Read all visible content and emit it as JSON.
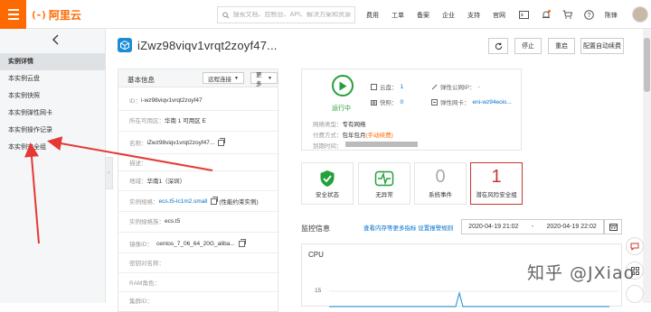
{
  "colors": {
    "brand": "#ff6a00",
    "link": "#0070cc",
    "running": "#23a03a",
    "risk": "#c7372f",
    "arrow": "#e53935"
  },
  "topbar": {
    "logo_text": "阿里云",
    "search_placeholder": "搜索文档、控制台、API、解决方案和资源",
    "nav": [
      "费用",
      "工单",
      "备案",
      "企业",
      "支持",
      "官网"
    ],
    "user_name": "陈锋",
    "icons": [
      "terminal-icon",
      "bell-icon",
      "cart-icon",
      "help-icon"
    ]
  },
  "sidebar": {
    "back_icon": "chevron-left-icon",
    "items": [
      {
        "label": "实例详情",
        "active": true
      },
      {
        "label": "本实例云盘",
        "active": false
      },
      {
        "label": "本实例快照",
        "active": false
      },
      {
        "label": "本实例弹性网卡",
        "active": false
      },
      {
        "label": "本实例操作记录",
        "active": false
      },
      {
        "label": "本实例安全组",
        "active": false
      }
    ]
  },
  "instance": {
    "title": "iZwz98viqv1vrqt2zoyf47...",
    "buttons": {
      "stop": "停止",
      "restart": "重启",
      "autorenew": "配置自动续费"
    }
  },
  "basic_info": {
    "title": "基本信息",
    "remote_btn": "远程连接",
    "more_btn": "更多",
    "rows": {
      "id": {
        "k": "ID：",
        "v": "i-wz98viqv1vrqt2zoyf47"
      },
      "zone": {
        "k": "所在可用区：",
        "v": "华南 1 可用区 E"
      },
      "name": {
        "k": "名称：",
        "v": "iZwz98viqv1vrqt2zoyf47..."
      },
      "desc": {
        "k": "描述：",
        "v": ""
      },
      "region": {
        "k": "地域：",
        "v": "华南1（深圳）"
      },
      "spec": {
        "k": "实例规格：",
        "v": "ecs.t5-lc1m2.small",
        "extra": "(性能约束实例)"
      },
      "family": {
        "k": "实例规格族：",
        "v": "ecs.t5"
      },
      "image": {
        "k": "镜像ID：",
        "v": "centos_7_06_64_20G_aliba..."
      },
      "keypair": {
        "k": "密钥对名称：",
        "v": ""
      },
      "ram": {
        "k": "RAM角色：",
        "v": ""
      },
      "group": {
        "k": "集群ID：",
        "v": ""
      }
    }
  },
  "status": {
    "run_label": "运行中",
    "disk_label": "云盘：",
    "disk_count": "1",
    "snapshot_label": "快照：",
    "snapshot_count": "0",
    "eip_label": "弹性公网IP：",
    "eip_value": "-",
    "eni_label": "弹性网卡：",
    "eni_value": "eni-wz94eois...",
    "net_type_label": "网络类型：",
    "net_type_value": "专有网络",
    "pay_label": "付费方式：",
    "pay_value": "包年包月",
    "pay_warn": "(手动续费)",
    "expire_label": "到期时间："
  },
  "cards": [
    {
      "label": "安全状态",
      "icon": "shield-check-icon"
    },
    {
      "label": "无异常",
      "icon": "heartbeat-icon"
    },
    {
      "label": "系统事件",
      "value": "0"
    },
    {
      "label": "潜在风险安全组",
      "value": "1"
    }
  ],
  "monitor": {
    "title": "监控信息",
    "link": "查看内存等更多指标 设置报警规则",
    "start": "2020-04-19 21:02",
    "dash": "-",
    "end": "2020-04-19 22:02",
    "chart_title": "CPU",
    "tick": "15"
  },
  "watermark": "知乎 @JXiao"
}
